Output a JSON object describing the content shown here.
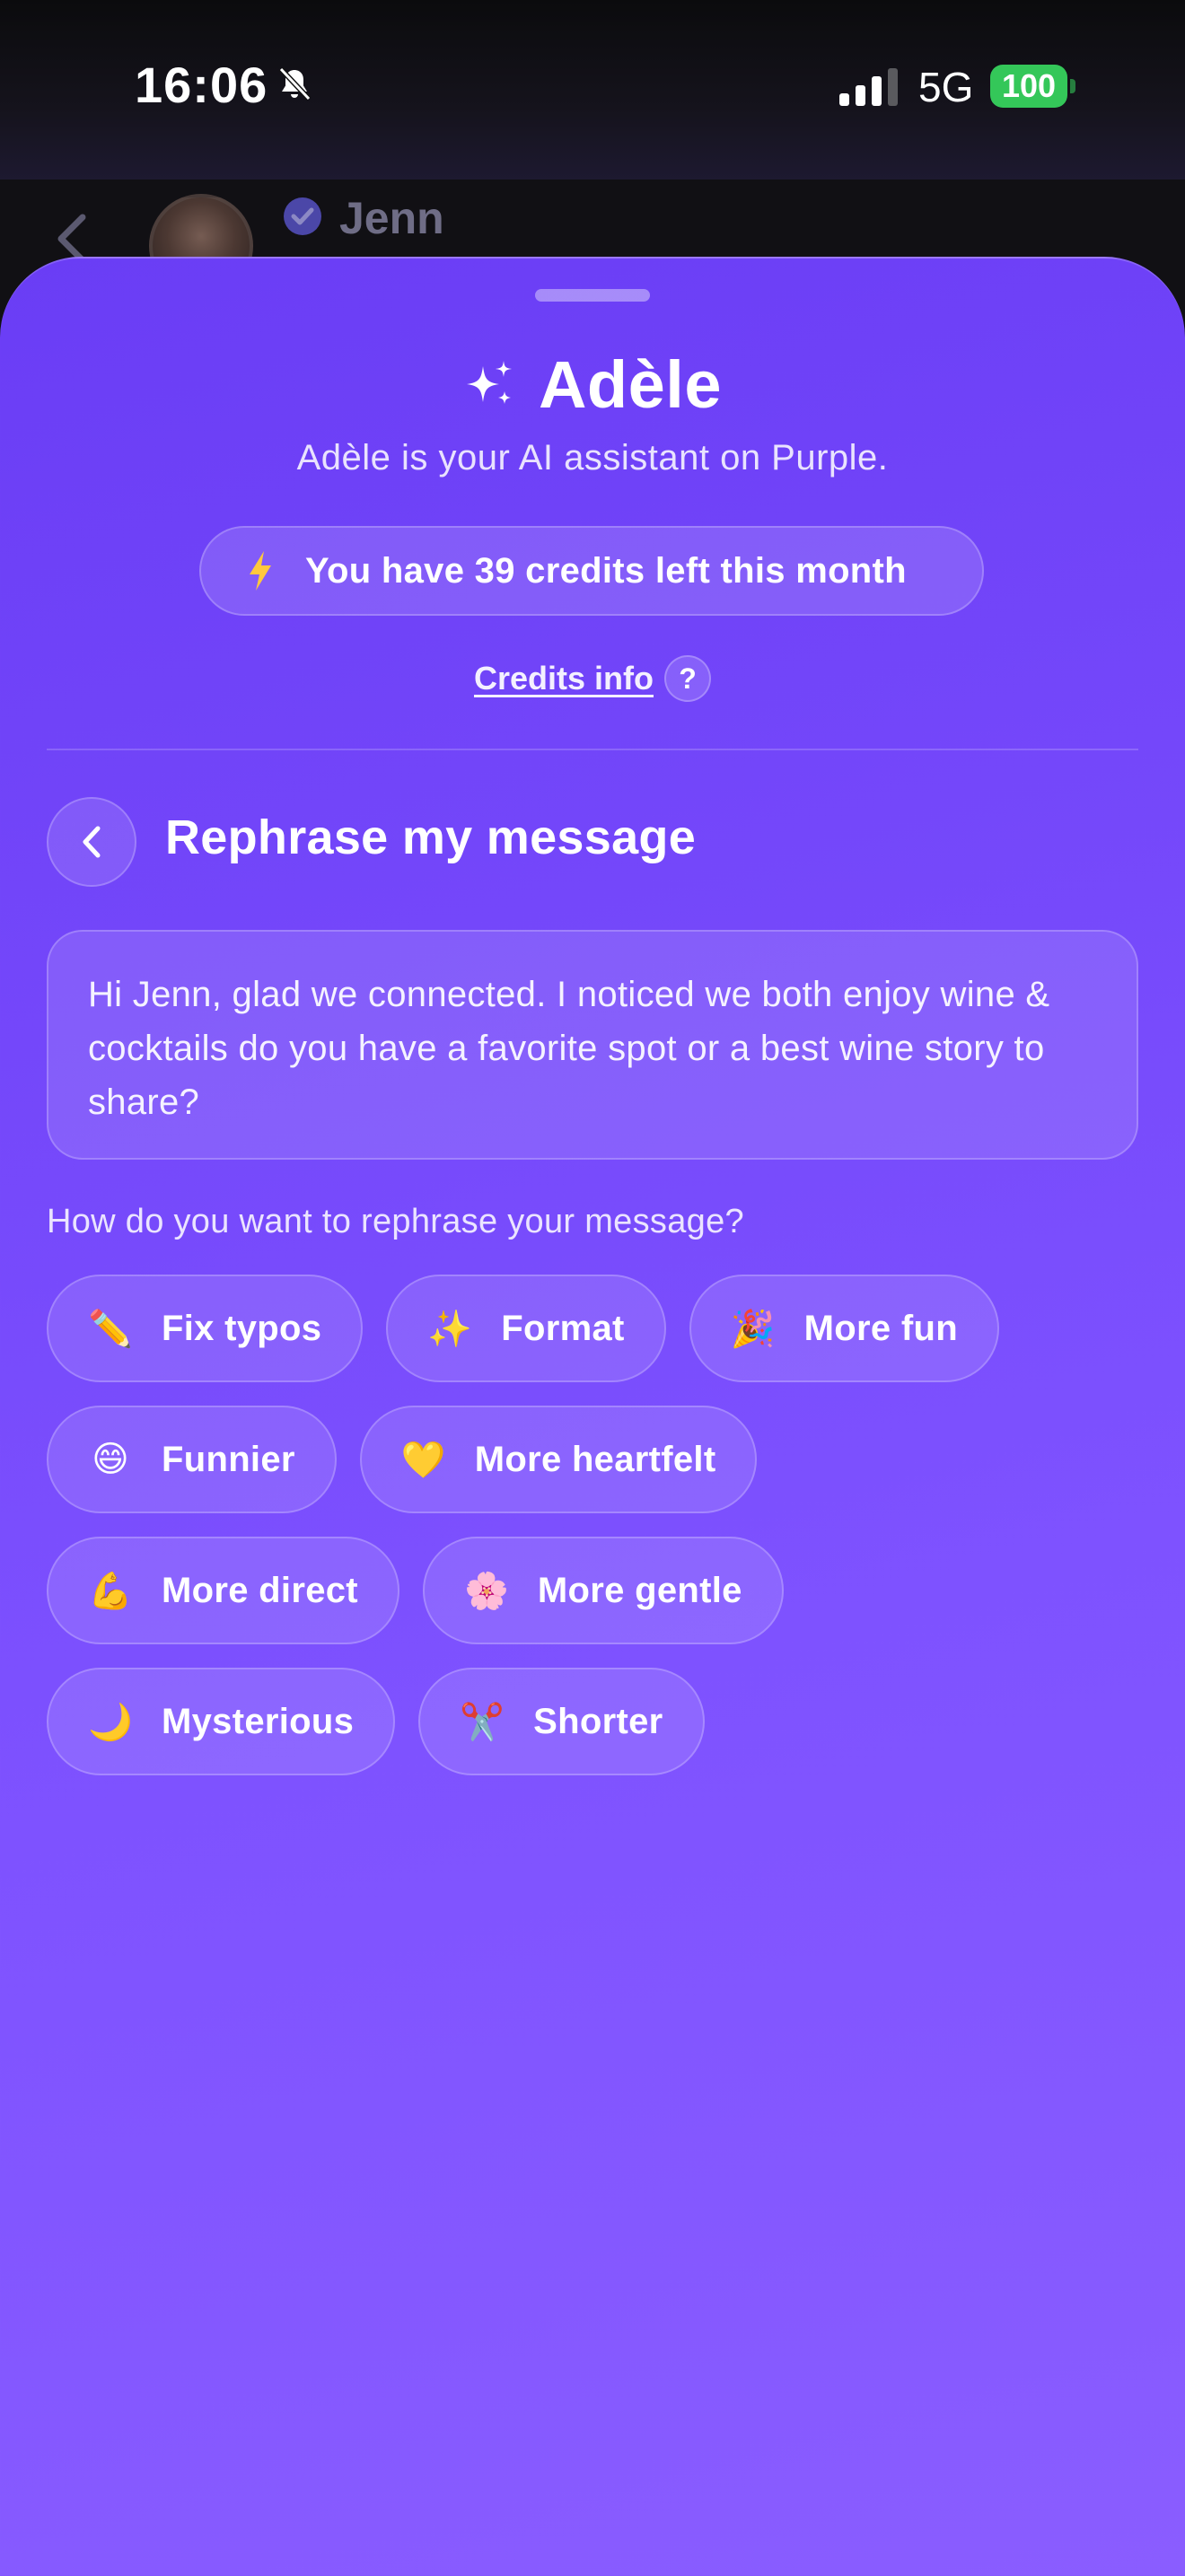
{
  "status_bar": {
    "time": "16:06",
    "network": "5G",
    "battery": "100"
  },
  "background_chat": {
    "name": "Jenn"
  },
  "sheet": {
    "title": "Adèle",
    "subtitle": "Adèle is your AI assistant on Purple.",
    "credits_text": "You have 39 credits left this month",
    "credits_info_link": "Credits info",
    "help_symbol": "?",
    "section_title": "Rephrase my message",
    "message_text": "Hi Jenn, glad we connected. I noticed we both enjoy wine & cocktails do you have a favorite spot or a best wine story to share?",
    "question": "How do you want to rephrase your message?",
    "options": [
      {
        "icon": "pencil-icon",
        "label": "Fix typos"
      },
      {
        "icon": "sparkles-icon",
        "label": "Format"
      },
      {
        "icon": "party-popper-icon",
        "label": "More fun"
      },
      {
        "icon": "grinning-face-icon",
        "label": "Funnier"
      },
      {
        "icon": "yellow-heart-icon",
        "label": "More heartfelt"
      },
      {
        "icon": "flexed-biceps-icon",
        "label": "More direct"
      },
      {
        "icon": "cherry-blossom-icon",
        "label": "More gentle"
      },
      {
        "icon": "crescent-moon-icon",
        "label": "Mysterious"
      },
      {
        "icon": "scissors-icon",
        "label": "Shorter"
      }
    ]
  },
  "colors": {
    "sheet_top": "#6a3df5",
    "sheet_bottom": "#8a5dff",
    "battery": "#34c759",
    "bolt": "#ffc83d"
  }
}
